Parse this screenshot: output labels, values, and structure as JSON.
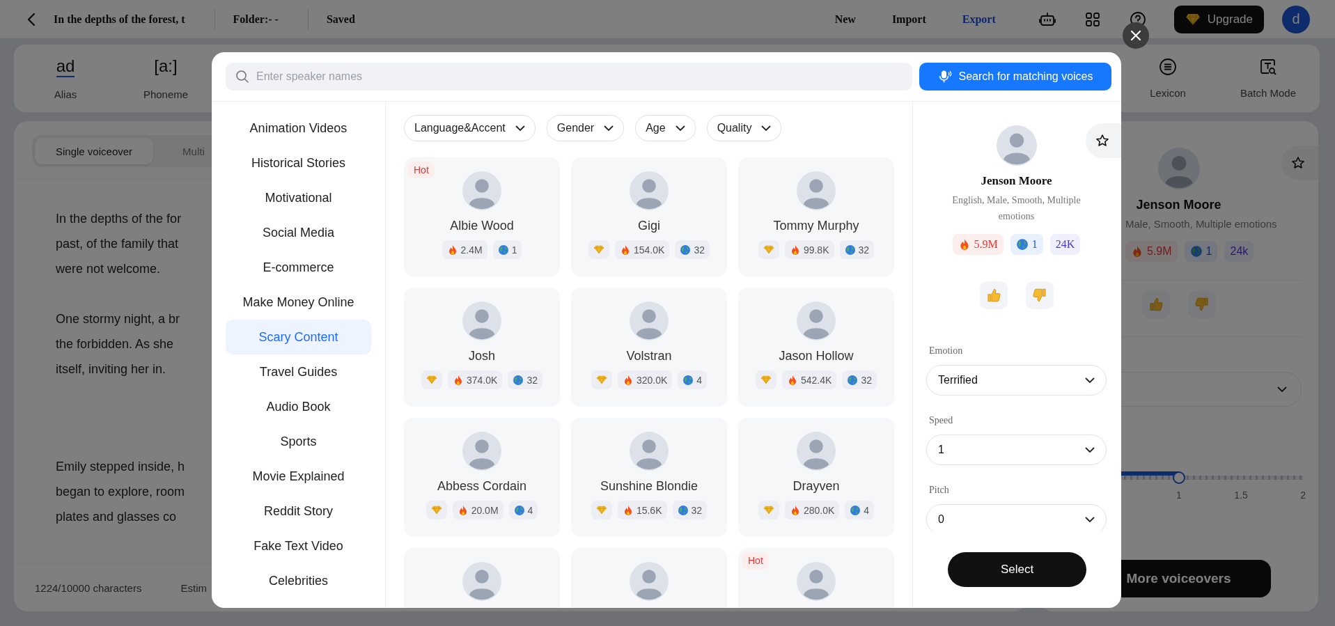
{
  "top_bar": {
    "title": "In the depths of the forest, t",
    "folder": "Folder:- -",
    "save_status": "Saved",
    "menu": [
      {
        "label": "New",
        "selected": false
      },
      {
        "label": "Import",
        "selected": false
      },
      {
        "label": "Export",
        "selected": true
      }
    ],
    "upgrade_label": "Upgrade",
    "avatar_letter": "d"
  },
  "toolbar": {
    "left": [
      {
        "kind": "text-icon",
        "icon_text": "ad",
        "label": "Alias"
      },
      {
        "kind": "text-icon",
        "icon_text": "[a:]",
        "label": "Phoneme"
      }
    ],
    "right": [
      {
        "kind": "lexicon",
        "label": "Lexicon"
      },
      {
        "kind": "batch",
        "label": "Batch Mode"
      }
    ]
  },
  "editor": {
    "tabs": [
      {
        "label": "Single voiceover",
        "selected": true
      },
      {
        "label": "Multi",
        "selected": false
      }
    ],
    "paragraphs": [
      [
        "In the depths of the for",
        "past, of the family that",
        "were not welcome."
      ],
      [
        "One stormy night, a br",
        "the forbidden. As she",
        "itself, inviting her in."
      ],
      [
        "Emily stepped inside, h",
        "began to explore, room",
        "plates and glasses co"
      ]
    ],
    "char_count": "1224/10000 characters",
    "estimate": "Estim"
  },
  "voice_panel": {
    "name": "Jenson Moore",
    "description": "Male, Smooth, Multiple emotions",
    "plays": "5.9M",
    "languages": "1",
    "likes": "24k",
    "speed_slider": {
      "level": 0.5,
      "ticks": [
        "1",
        "1.5",
        "2"
      ]
    },
    "button": "More voiceovers"
  },
  "modal": {
    "search": {
      "placeholder": "Enter speaker names"
    },
    "search_button": "Search for matching voices",
    "categories": [
      {
        "label": "Animation Videos",
        "selected": false
      },
      {
        "label": "Historical Stories",
        "selected": false
      },
      {
        "label": "Motivational",
        "selected": false
      },
      {
        "label": "Social Media",
        "selected": false
      },
      {
        "label": "E-commerce",
        "selected": false
      },
      {
        "label": "Make Money Online",
        "selected": false
      },
      {
        "label": "Scary Content",
        "selected": true
      },
      {
        "label": "Travel Guides",
        "selected": false
      },
      {
        "label": "Audio Book",
        "selected": false
      },
      {
        "label": "Sports",
        "selected": false
      },
      {
        "label": "Movie Explained",
        "selected": false
      },
      {
        "label": "Reddit Story",
        "selected": false
      },
      {
        "label": "Fake Text Video",
        "selected": false
      },
      {
        "label": "Celebrities",
        "selected": false
      }
    ],
    "filters": [
      "Language&Accent",
      "Gender",
      "Age",
      "Quality"
    ],
    "voices": [
      {
        "kind": "full",
        "name": "Albie Wood",
        "badge": "Hot",
        "premium": false,
        "plays": "2.4M",
        "languages": "1"
      },
      {
        "kind": "full",
        "name": "Gigi",
        "premium": true,
        "plays": "154.0K",
        "languages": "32"
      },
      {
        "kind": "full",
        "name": "Tommy Murphy",
        "premium": true,
        "plays": "99.8K",
        "languages": "32"
      },
      {
        "kind": "full",
        "name": "Josh",
        "premium": true,
        "plays": "374.0K",
        "languages": "32"
      },
      {
        "kind": "full",
        "name": "Volstran",
        "premium": true,
        "plays": "320.0K",
        "languages": "4"
      },
      {
        "kind": "full",
        "name": "Jason Hollow",
        "premium": true,
        "plays": "542.4K",
        "languages": "32"
      },
      {
        "kind": "full",
        "name": "Abbess Cordain",
        "premium": true,
        "plays": "20.0M",
        "languages": "4"
      },
      {
        "kind": "full",
        "name": "Sunshine Blondie",
        "premium": true,
        "plays": "15.6K",
        "languages": "32"
      },
      {
        "kind": "full",
        "name": "Drayven",
        "premium": true,
        "plays": "280.0K",
        "languages": "4"
      },
      {
        "kind": "cut"
      },
      {
        "kind": "cut"
      },
      {
        "kind": "cut",
        "badge": "Hot"
      }
    ],
    "detail": {
      "name": "Jenson Moore",
      "description": "English, Male, Smooth, Multiple emotions",
      "plays": "5.9M",
      "languages": "1",
      "likes": "24K",
      "settings": [
        {
          "label": "Emotion",
          "value": "Terrified"
        },
        {
          "label": "Speed",
          "value": "1"
        },
        {
          "label": "Pitch",
          "value": "0"
        }
      ],
      "select_button": "Select"
    }
  }
}
